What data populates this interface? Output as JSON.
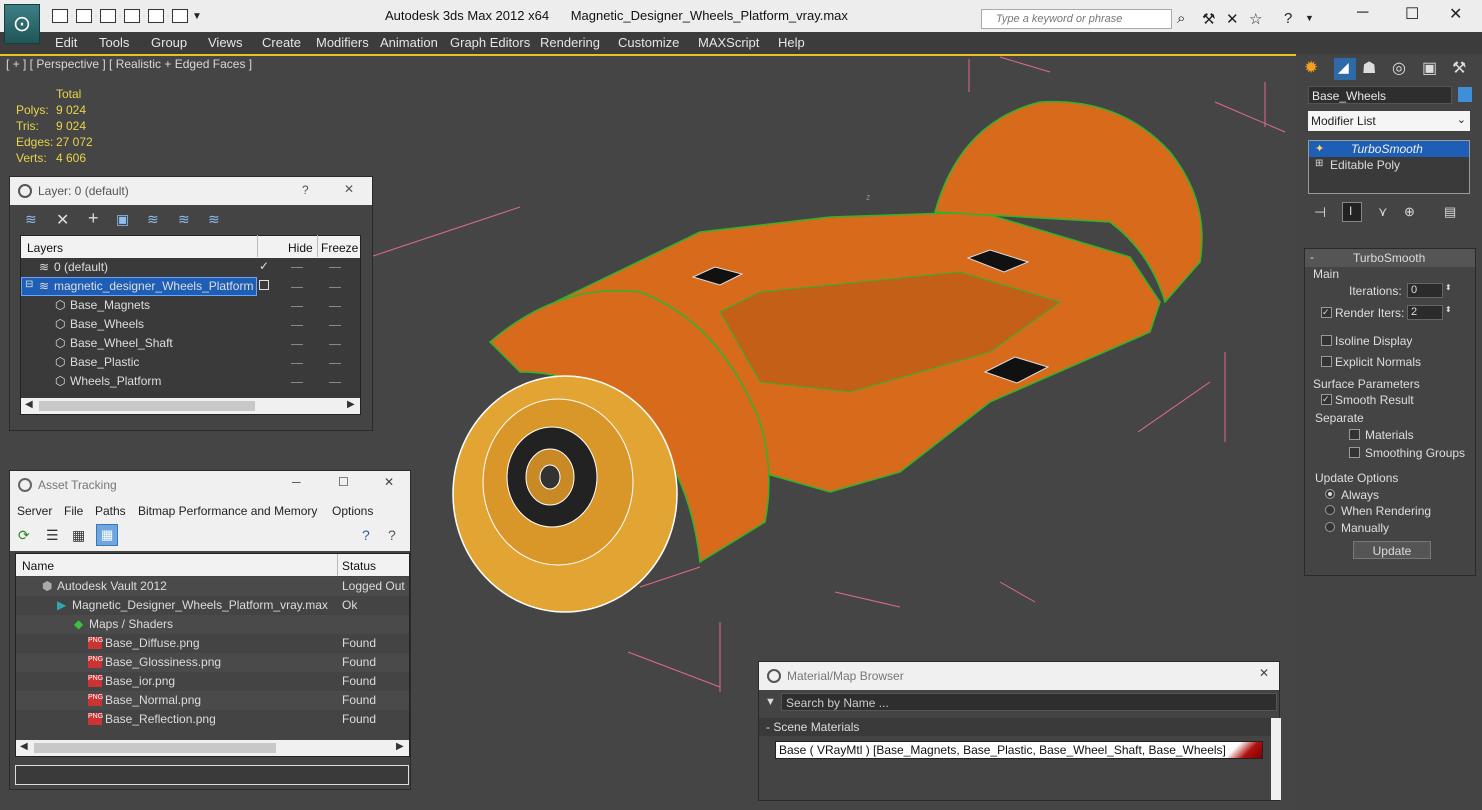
{
  "app": {
    "title": "Autodesk 3ds Max  2012 x64",
    "filename": "Magnetic_Designer_Wheels_Platform_vray.max",
    "search_placeholder": "Type a keyword or phrase"
  },
  "menu": [
    "Edit",
    "Tools",
    "Group",
    "Views",
    "Create",
    "Modifiers",
    "Animation",
    "Graph Editors",
    "Rendering",
    "Customize",
    "MAXScript",
    "Help"
  ],
  "viewport": {
    "label": "[ + ] [ Perspective ] [ Realistic + Edged Faces ]",
    "stats": {
      "header": "Total",
      "rows": [
        {
          "label": "Polys:",
          "value": "9 024"
        },
        {
          "label": "Tris:",
          "value": "9 024"
        },
        {
          "label": "Edges:",
          "value": "27 072"
        },
        {
          "label": "Verts:",
          "value": "4 606"
        }
      ]
    }
  },
  "layer_window": {
    "title": "Layer: 0 (default)",
    "help": "?",
    "close": "✕",
    "columns": [
      "Layers",
      "Hide",
      "Freeze"
    ],
    "rows": [
      {
        "name": "0 (default)",
        "level": 0,
        "selected": false
      },
      {
        "name": "magnetic_designer_Wheels_Platform",
        "level": 0,
        "selected": true
      },
      {
        "name": "Base_Magnets",
        "level": 1,
        "selected": false
      },
      {
        "name": "Base_Wheels",
        "level": 1,
        "selected": false
      },
      {
        "name": "Base_Wheel_Shaft",
        "level": 1,
        "selected": false
      },
      {
        "name": "Base_Plastic",
        "level": 1,
        "selected": false
      },
      {
        "name": "Wheels_Platform",
        "level": 1,
        "selected": false
      }
    ]
  },
  "asset_window": {
    "title": "Asset Tracking",
    "menu": [
      "Server",
      "File",
      "Paths",
      "Bitmap Performance and Memory",
      "Options"
    ],
    "columns": [
      "Name",
      "Status"
    ],
    "rows": [
      {
        "name": "Autodesk Vault 2012",
        "status": "Logged Out",
        "indent": 1
      },
      {
        "name": "Magnetic_Designer_Wheels_Platform_vray.max",
        "status": "Ok",
        "indent": 2
      },
      {
        "name": "Maps / Shaders",
        "status": "",
        "indent": 3
      },
      {
        "name": "Base_Diffuse.png",
        "status": "Found",
        "indent": 4
      },
      {
        "name": "Base_Glossiness.png",
        "status": "Found",
        "indent": 4
      },
      {
        "name": "Base_ior.png",
        "status": "Found",
        "indent": 4
      },
      {
        "name": "Base_Normal.png",
        "status": "Found",
        "indent": 4
      },
      {
        "name": "Base_Reflection.png",
        "status": "Found",
        "indent": 4
      }
    ]
  },
  "material_window": {
    "title": "Material/Map Browser",
    "search_placeholder": "Search by Name ...",
    "section": "- Scene Materials",
    "material_entry": "Base  ( VRayMtl )  [Base_Magnets, Base_Plastic, Base_Wheel_Shaft, Base_Wheels]"
  },
  "command_panel": {
    "object_name": "Base_Wheels",
    "modifier_list": "Modifier List",
    "stack": [
      "TurboSmooth",
      "Editable Poly"
    ],
    "rollout_title": "TurboSmooth",
    "main_group": "Main",
    "iterations_label": "Iterations:",
    "iterations_value": "0",
    "render_iters_label": "Render Iters:",
    "render_iters_value": "2",
    "isoline_label": "Isoline Display",
    "explicit_normals_label": "Explicit Normals",
    "surface_group": "Surface Parameters",
    "smooth_result_label": "Smooth Result",
    "separate_label": "Separate",
    "materials_label": "Materials",
    "smoothing_groups_label": "Smoothing Groups",
    "update_group": "Update Options",
    "update_options": [
      "Always",
      "When Rendering",
      "Manually"
    ],
    "update_button": "Update"
  },
  "colors": {
    "platform": "#d86a1c",
    "wheel": "#e2a533",
    "wire": "#2cb52c",
    "selection": "#1e5fb5",
    "gizmo": "#e06a8c"
  }
}
